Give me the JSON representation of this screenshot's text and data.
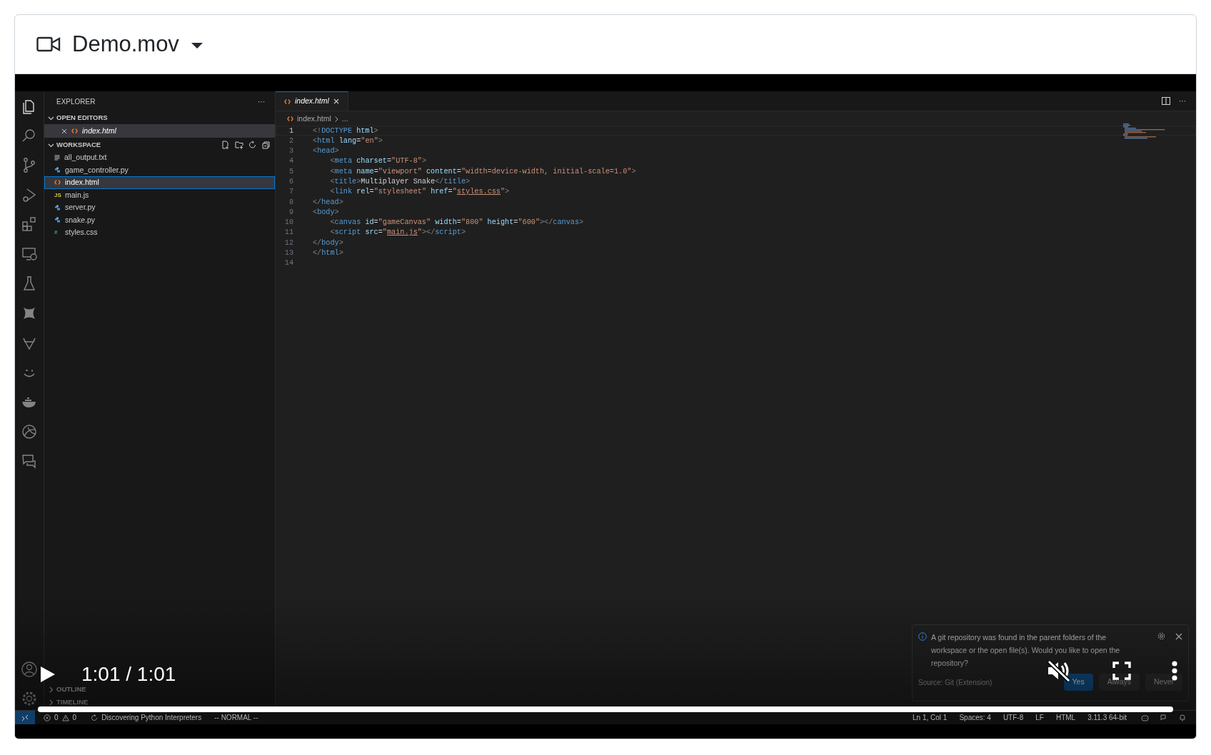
{
  "header": {
    "title": "Demo.mov"
  },
  "explorer": {
    "title": "EXPLORER",
    "more": "···",
    "open_editors": {
      "title": "OPEN EDITORS",
      "expanded": true,
      "items": [
        {
          "name": "index.html",
          "kind": "html",
          "selected": true
        }
      ]
    },
    "workspace": {
      "title": "WORKSPACE",
      "expanded": true,
      "files": [
        {
          "name": "all_output.txt",
          "kind": "txt",
          "selected": false
        },
        {
          "name": "game_controller.py",
          "kind": "python",
          "selected": false
        },
        {
          "name": "index.html",
          "kind": "html",
          "selected": true
        },
        {
          "name": "main.js",
          "kind": "js",
          "glyph": "JS",
          "selected": false
        },
        {
          "name": "server.py",
          "kind": "python",
          "selected": false
        },
        {
          "name": "snake.py",
          "kind": "python",
          "selected": false
        },
        {
          "name": "styles.css",
          "kind": "css",
          "glyph": "#",
          "selected": false
        }
      ]
    },
    "collapsed_sections": [
      {
        "title": "OUTLINE"
      },
      {
        "title": "TIMELINE"
      }
    ]
  },
  "editor": {
    "tab": {
      "name": "index.html",
      "selected": true
    },
    "breadcrumb": {
      "file": "index.html",
      "rest": "..."
    },
    "more": "···",
    "lines": [
      {
        "number": "1",
        "current": true,
        "tokens": [
          {
            "kind": "punct",
            "text": "<!"
          },
          {
            "kind": "tag",
            "text": "DOCTYPE"
          },
          {
            "kind": "attr",
            "text": " html"
          },
          {
            "kind": "punct",
            "text": ">"
          }
        ]
      },
      {
        "number": "2",
        "current": false,
        "tokens": [
          {
            "kind": "punct",
            "text": "<"
          },
          {
            "kind": "tag",
            "text": "html"
          },
          {
            "kind": "attr",
            "text": " lang"
          },
          {
            "kind": "text",
            "text": "="
          },
          {
            "kind": "string",
            "text": "\"en\""
          },
          {
            "kind": "punct",
            "text": ">"
          }
        ]
      },
      {
        "number": "3",
        "current": false,
        "tokens": [
          {
            "kind": "punct",
            "text": "<"
          },
          {
            "kind": "tag",
            "text": "head"
          },
          {
            "kind": "punct",
            "text": ">"
          }
        ]
      },
      {
        "number": "4",
        "current": false,
        "tokens": [
          {
            "kind": "punct",
            "text": "    <"
          },
          {
            "kind": "tag",
            "text": "meta"
          },
          {
            "kind": "attr",
            "text": " charset"
          },
          {
            "kind": "text",
            "text": "="
          },
          {
            "kind": "string",
            "text": "\"UTF-8\""
          },
          {
            "kind": "punct",
            "text": ">"
          }
        ]
      },
      {
        "number": "5",
        "current": false,
        "tokens": [
          {
            "kind": "punct",
            "text": "    <"
          },
          {
            "kind": "tag",
            "text": "meta"
          },
          {
            "kind": "attr",
            "text": " name"
          },
          {
            "kind": "text",
            "text": "="
          },
          {
            "kind": "string",
            "text": "\"viewport\""
          },
          {
            "kind": "attr",
            "text": " content"
          },
          {
            "kind": "text",
            "text": "="
          },
          {
            "kind": "string",
            "text": "\"width=device-width, initial-scale=1.0\""
          },
          {
            "kind": "punct",
            "text": ">"
          }
        ]
      },
      {
        "number": "6",
        "current": false,
        "tokens": [
          {
            "kind": "punct",
            "text": "    <"
          },
          {
            "kind": "tag",
            "text": "title"
          },
          {
            "kind": "punct",
            "text": ">"
          },
          {
            "kind": "text",
            "text": "Multiplayer Snake"
          },
          {
            "kind": "punct",
            "text": "</"
          },
          {
            "kind": "tag",
            "text": "title"
          },
          {
            "kind": "punct",
            "text": ">"
          }
        ]
      },
      {
        "number": "7",
        "current": false,
        "tokens": [
          {
            "kind": "punct",
            "text": "    <"
          },
          {
            "kind": "tag",
            "text": "link"
          },
          {
            "kind": "attr",
            "text": " rel"
          },
          {
            "kind": "text",
            "text": "="
          },
          {
            "kind": "string",
            "text": "\"stylesheet\""
          },
          {
            "kind": "attr",
            "text": " href"
          },
          {
            "kind": "text",
            "text": "="
          },
          {
            "kind": "string",
            "text": "\""
          },
          {
            "kind": "link",
            "text": "styles.css"
          },
          {
            "kind": "string",
            "text": "\""
          },
          {
            "kind": "punct",
            "text": ">"
          }
        ]
      },
      {
        "number": "8",
        "current": false,
        "tokens": [
          {
            "kind": "punct",
            "text": "</"
          },
          {
            "kind": "tag",
            "text": "head"
          },
          {
            "kind": "punct",
            "text": ">"
          }
        ]
      },
      {
        "number": "9",
        "current": false,
        "tokens": [
          {
            "kind": "punct",
            "text": "<"
          },
          {
            "kind": "tag",
            "text": "body"
          },
          {
            "kind": "punct",
            "text": ">"
          }
        ]
      },
      {
        "number": "10",
        "current": false,
        "tokens": [
          {
            "kind": "punct",
            "text": "    <"
          },
          {
            "kind": "tag",
            "text": "canvas"
          },
          {
            "kind": "attr",
            "text": " id"
          },
          {
            "kind": "text",
            "text": "="
          },
          {
            "kind": "string",
            "text": "\"gameCanvas\""
          },
          {
            "kind": "attr",
            "text": " width"
          },
          {
            "kind": "text",
            "text": "="
          },
          {
            "kind": "string",
            "text": "\"800\""
          },
          {
            "kind": "attr",
            "text": " height"
          },
          {
            "kind": "text",
            "text": "="
          },
          {
            "kind": "string",
            "text": "\"600\""
          },
          {
            "kind": "punct",
            "text": "></"
          },
          {
            "kind": "tag",
            "text": "canvas"
          },
          {
            "kind": "punct",
            "text": ">"
          }
        ]
      },
      {
        "number": "11",
        "current": false,
        "tokens": [
          {
            "kind": "punct",
            "text": "    <"
          },
          {
            "kind": "tag",
            "text": "script"
          },
          {
            "kind": "attr",
            "text": " src"
          },
          {
            "kind": "text",
            "text": "="
          },
          {
            "kind": "string",
            "text": "\""
          },
          {
            "kind": "link",
            "text": "main.js"
          },
          {
            "kind": "string",
            "text": "\""
          },
          {
            "kind": "punct",
            "text": "></"
          },
          {
            "kind": "tag",
            "text": "script"
          },
          {
            "kind": "punct",
            "text": ">"
          }
        ]
      },
      {
        "number": "12",
        "current": false,
        "tokens": [
          {
            "kind": "punct",
            "text": "</"
          },
          {
            "kind": "tag",
            "text": "body"
          },
          {
            "kind": "punct",
            "text": ">"
          }
        ]
      },
      {
        "number": "13",
        "current": false,
        "tokens": [
          {
            "kind": "punct",
            "text": "</"
          },
          {
            "kind": "tag",
            "text": "html"
          },
          {
            "kind": "punct",
            "text": ">"
          }
        ]
      },
      {
        "number": "14",
        "current": false
      }
    ]
  },
  "notification": {
    "message": "A git repository was found in the parent folders of the workspace or the open file(s). Would you like to open the repository?",
    "source": "Source: Git (Extension)",
    "buttons": [
      {
        "label": "Yes",
        "primary": true
      },
      {
        "label": "Always",
        "primary": false
      },
      {
        "label": "Never",
        "primary": false
      }
    ]
  },
  "status_bar": {
    "errors": "0",
    "warnings": "0",
    "left": [
      {
        "kind": "sync",
        "text": "Discovering Python Interpreters"
      },
      {
        "kind": "plain",
        "text": "-- NORMAL --"
      }
    ],
    "right": [
      "Ln 1, Col 1",
      "Spaces: 4",
      "UTF-8",
      "LF",
      "HTML",
      "3.11.3 64-bit"
    ]
  },
  "player": {
    "playing": false,
    "time": "1:01 / 1:01",
    "muted": true,
    "progress": {
      "level": 1
    }
  }
}
